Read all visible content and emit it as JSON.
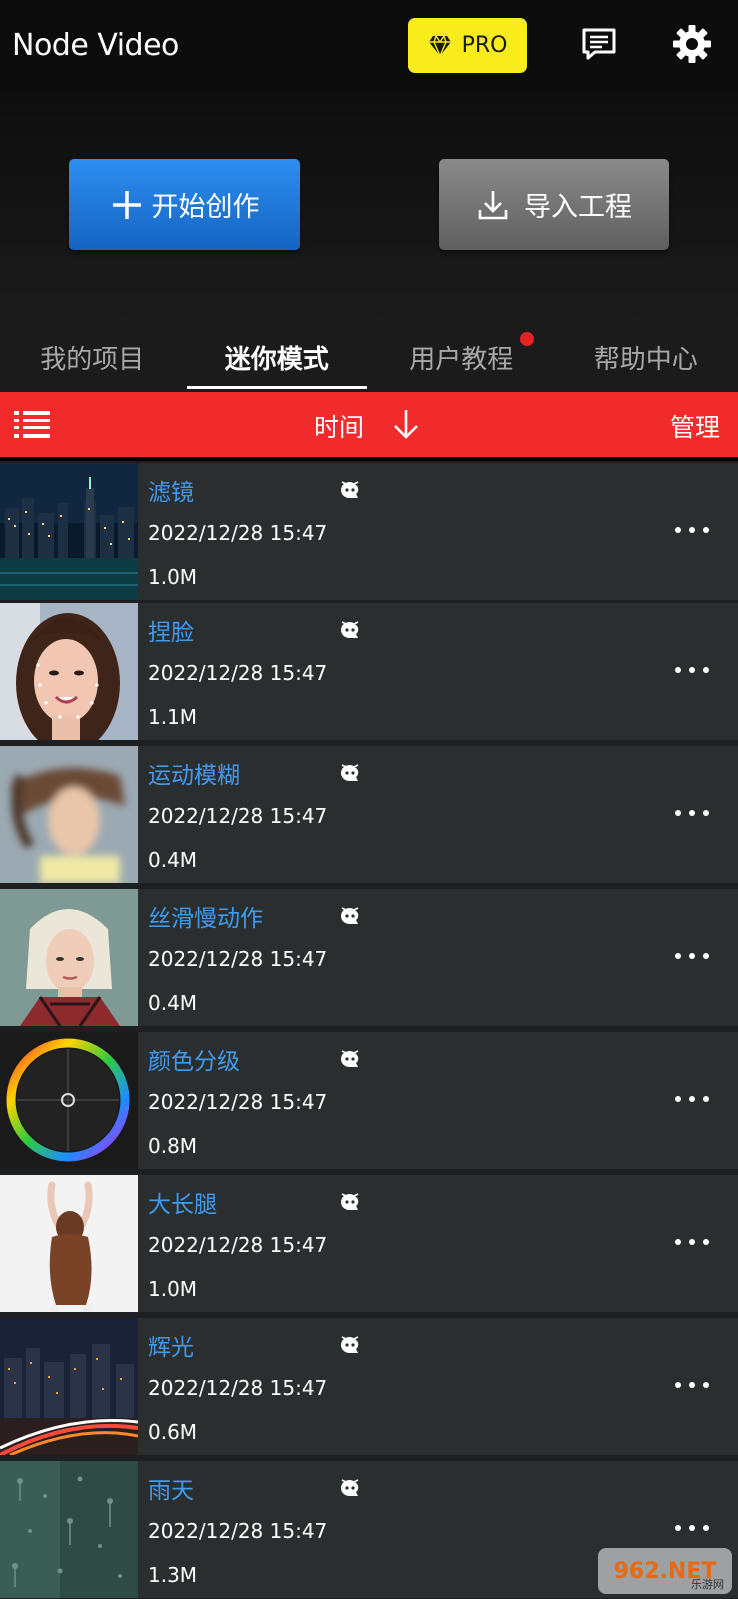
{
  "app": {
    "title": "Node Video"
  },
  "header": {
    "pro_label": "PRO",
    "pro_color": "#f9ec1d"
  },
  "actions": {
    "create_label": "开始创作",
    "import_label": "导入工程"
  },
  "tabs": [
    {
      "label": "我的项目",
      "active": false
    },
    {
      "label": "迷你模式",
      "active": true
    },
    {
      "label": "用户教程",
      "active": false,
      "badge_dot": true
    },
    {
      "label": "帮助中心",
      "active": false
    }
  ],
  "sortbar": {
    "sort_label": "时间",
    "manage_label": "管理",
    "color": "#f12b2b"
  },
  "projects": [
    {
      "title": "滤镜",
      "date": "2022/12/28 15:47",
      "size": "1.0M",
      "thumb": "city-night"
    },
    {
      "title": "捏脸",
      "date": "2022/12/28 15:47",
      "size": "1.1M",
      "thumb": "face"
    },
    {
      "title": "运动模糊",
      "date": "2022/12/28 15:47",
      "size": "0.4M",
      "thumb": "motion-blur"
    },
    {
      "title": "丝滑慢动作",
      "date": "2022/12/28 15:47",
      "size": "0.4M",
      "thumb": "portrait"
    },
    {
      "title": "颜色分级",
      "date": "2022/12/28 15:47",
      "size": "0.8M",
      "thumb": "color-wheel"
    },
    {
      "title": "大长腿",
      "date": "2022/12/28 15:47",
      "size": "1.0M",
      "thumb": "back-pose"
    },
    {
      "title": "辉光",
      "date": "2022/12/28 15:47",
      "size": "0.6M",
      "thumb": "city-lights"
    },
    {
      "title": "雨天",
      "date": "2022/12/28 15:47",
      "size": "1.3M",
      "thumb": "rain"
    }
  ],
  "watermark": {
    "main": "962.NET",
    "sub": "乐游网"
  }
}
